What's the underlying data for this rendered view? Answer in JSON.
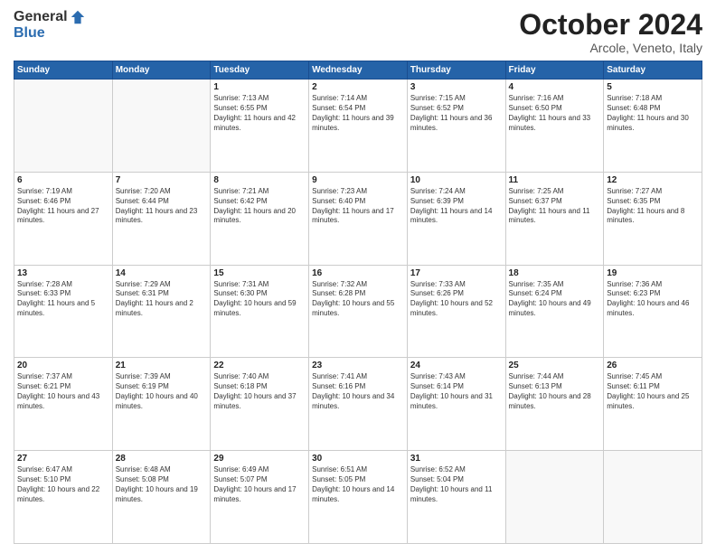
{
  "header": {
    "logo_general": "General",
    "logo_blue": "Blue",
    "month_title": "October 2024",
    "location": "Arcole, Veneto, Italy"
  },
  "weekdays": [
    "Sunday",
    "Monday",
    "Tuesday",
    "Wednesday",
    "Thursday",
    "Friday",
    "Saturday"
  ],
  "weeks": [
    [
      {
        "day": "",
        "empty": true
      },
      {
        "day": "",
        "empty": true
      },
      {
        "day": "1",
        "sunrise": "Sunrise: 7:13 AM",
        "sunset": "Sunset: 6:55 PM",
        "daylight": "Daylight: 11 hours and 42 minutes."
      },
      {
        "day": "2",
        "sunrise": "Sunrise: 7:14 AM",
        "sunset": "Sunset: 6:54 PM",
        "daylight": "Daylight: 11 hours and 39 minutes."
      },
      {
        "day": "3",
        "sunrise": "Sunrise: 7:15 AM",
        "sunset": "Sunset: 6:52 PM",
        "daylight": "Daylight: 11 hours and 36 minutes."
      },
      {
        "day": "4",
        "sunrise": "Sunrise: 7:16 AM",
        "sunset": "Sunset: 6:50 PM",
        "daylight": "Daylight: 11 hours and 33 minutes."
      },
      {
        "day": "5",
        "sunrise": "Sunrise: 7:18 AM",
        "sunset": "Sunset: 6:48 PM",
        "daylight": "Daylight: 11 hours and 30 minutes."
      }
    ],
    [
      {
        "day": "6",
        "sunrise": "Sunrise: 7:19 AM",
        "sunset": "Sunset: 6:46 PM",
        "daylight": "Daylight: 11 hours and 27 minutes."
      },
      {
        "day": "7",
        "sunrise": "Sunrise: 7:20 AM",
        "sunset": "Sunset: 6:44 PM",
        "daylight": "Daylight: 11 hours and 23 minutes."
      },
      {
        "day": "8",
        "sunrise": "Sunrise: 7:21 AM",
        "sunset": "Sunset: 6:42 PM",
        "daylight": "Daylight: 11 hours and 20 minutes."
      },
      {
        "day": "9",
        "sunrise": "Sunrise: 7:23 AM",
        "sunset": "Sunset: 6:40 PM",
        "daylight": "Daylight: 11 hours and 17 minutes."
      },
      {
        "day": "10",
        "sunrise": "Sunrise: 7:24 AM",
        "sunset": "Sunset: 6:39 PM",
        "daylight": "Daylight: 11 hours and 14 minutes."
      },
      {
        "day": "11",
        "sunrise": "Sunrise: 7:25 AM",
        "sunset": "Sunset: 6:37 PM",
        "daylight": "Daylight: 11 hours and 11 minutes."
      },
      {
        "day": "12",
        "sunrise": "Sunrise: 7:27 AM",
        "sunset": "Sunset: 6:35 PM",
        "daylight": "Daylight: 11 hours and 8 minutes."
      }
    ],
    [
      {
        "day": "13",
        "sunrise": "Sunrise: 7:28 AM",
        "sunset": "Sunset: 6:33 PM",
        "daylight": "Daylight: 11 hours and 5 minutes."
      },
      {
        "day": "14",
        "sunrise": "Sunrise: 7:29 AM",
        "sunset": "Sunset: 6:31 PM",
        "daylight": "Daylight: 11 hours and 2 minutes."
      },
      {
        "day": "15",
        "sunrise": "Sunrise: 7:31 AM",
        "sunset": "Sunset: 6:30 PM",
        "daylight": "Daylight: 10 hours and 59 minutes."
      },
      {
        "day": "16",
        "sunrise": "Sunrise: 7:32 AM",
        "sunset": "Sunset: 6:28 PM",
        "daylight": "Daylight: 10 hours and 55 minutes."
      },
      {
        "day": "17",
        "sunrise": "Sunrise: 7:33 AM",
        "sunset": "Sunset: 6:26 PM",
        "daylight": "Daylight: 10 hours and 52 minutes."
      },
      {
        "day": "18",
        "sunrise": "Sunrise: 7:35 AM",
        "sunset": "Sunset: 6:24 PM",
        "daylight": "Daylight: 10 hours and 49 minutes."
      },
      {
        "day": "19",
        "sunrise": "Sunrise: 7:36 AM",
        "sunset": "Sunset: 6:23 PM",
        "daylight": "Daylight: 10 hours and 46 minutes."
      }
    ],
    [
      {
        "day": "20",
        "sunrise": "Sunrise: 7:37 AM",
        "sunset": "Sunset: 6:21 PM",
        "daylight": "Daylight: 10 hours and 43 minutes."
      },
      {
        "day": "21",
        "sunrise": "Sunrise: 7:39 AM",
        "sunset": "Sunset: 6:19 PM",
        "daylight": "Daylight: 10 hours and 40 minutes."
      },
      {
        "day": "22",
        "sunrise": "Sunrise: 7:40 AM",
        "sunset": "Sunset: 6:18 PM",
        "daylight": "Daylight: 10 hours and 37 minutes."
      },
      {
        "day": "23",
        "sunrise": "Sunrise: 7:41 AM",
        "sunset": "Sunset: 6:16 PM",
        "daylight": "Daylight: 10 hours and 34 minutes."
      },
      {
        "day": "24",
        "sunrise": "Sunrise: 7:43 AM",
        "sunset": "Sunset: 6:14 PM",
        "daylight": "Daylight: 10 hours and 31 minutes."
      },
      {
        "day": "25",
        "sunrise": "Sunrise: 7:44 AM",
        "sunset": "Sunset: 6:13 PM",
        "daylight": "Daylight: 10 hours and 28 minutes."
      },
      {
        "day": "26",
        "sunrise": "Sunrise: 7:45 AM",
        "sunset": "Sunset: 6:11 PM",
        "daylight": "Daylight: 10 hours and 25 minutes."
      }
    ],
    [
      {
        "day": "27",
        "sunrise": "Sunrise: 6:47 AM",
        "sunset": "Sunset: 5:10 PM",
        "daylight": "Daylight: 10 hours and 22 minutes."
      },
      {
        "day": "28",
        "sunrise": "Sunrise: 6:48 AM",
        "sunset": "Sunset: 5:08 PM",
        "daylight": "Daylight: 10 hours and 19 minutes."
      },
      {
        "day": "29",
        "sunrise": "Sunrise: 6:49 AM",
        "sunset": "Sunset: 5:07 PM",
        "daylight": "Daylight: 10 hours and 17 minutes."
      },
      {
        "day": "30",
        "sunrise": "Sunrise: 6:51 AM",
        "sunset": "Sunset: 5:05 PM",
        "daylight": "Daylight: 10 hours and 14 minutes."
      },
      {
        "day": "31",
        "sunrise": "Sunrise: 6:52 AM",
        "sunset": "Sunset: 5:04 PM",
        "daylight": "Daylight: 10 hours and 11 minutes."
      },
      {
        "day": "",
        "empty": true
      },
      {
        "day": "",
        "empty": true
      }
    ]
  ]
}
